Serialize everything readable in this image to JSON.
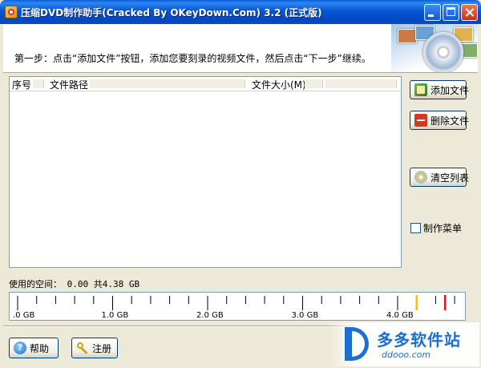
{
  "window": {
    "title": "压缩DVD制作助手(Cracked By OKeyDown.Com) 3.2 (正式版)",
    "controls": [
      "minimize-icon",
      "maximize-icon",
      "close-icon"
    ]
  },
  "header": {
    "step_text": "第一步：点击“添加文件”按钮，添加您要刻录的视频文件，然后点击“下一步”继续。"
  },
  "file_list": {
    "columns": [
      "序号",
      "文件路径",
      "文件大小(M)"
    ],
    "rows": []
  },
  "side_buttons": {
    "add_file": "添加文件",
    "delete_file": "删除文件",
    "clear_list": "清空列表",
    "make_menu": "制作菜单"
  },
  "make_menu_checked": false,
  "space": {
    "used_label": "使用的空间：",
    "used_value": "0.00",
    "total_label": "共4.38 GB"
  },
  "chart_data": {
    "type": "gauge",
    "tick_labels": [
      ".0 GB",
      "1.0 GB",
      "2.0 GB",
      "3.0 GB",
      "4.0 GB"
    ],
    "range_gb": [
      0,
      4.6
    ],
    "used_gb": 0.0,
    "markers": [
      {
        "value_gb": 4.2,
        "color": "#F0C020"
      },
      {
        "value_gb": 4.5,
        "color": "#C8201C"
      }
    ]
  },
  "bottom_buttons": {
    "help": "帮助",
    "register": "注册"
  },
  "watermark": {
    "name": "多多软件站",
    "url": "ddooo.com"
  },
  "colors": {
    "titlebar": "#0A5FD8",
    "window_bg": "#ECE9D8",
    "border": "#7F9DB9"
  }
}
